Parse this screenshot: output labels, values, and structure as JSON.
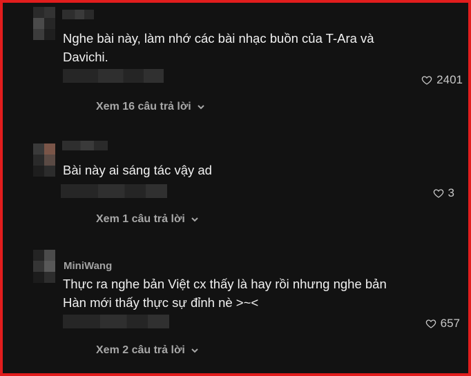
{
  "comments": [
    {
      "username": "",
      "text": "Nghe bài này, làm nhớ các bài nhạc buồn của T-Ara và Davichi.",
      "likes": "2401",
      "replies_label": "Xem 16 câu trả lời"
    },
    {
      "username": "",
      "text": "Bài này ai sáng tác vậy ad",
      "likes": "3",
      "replies_label": "Xem 1 câu trả lời"
    },
    {
      "username": "MiniWang",
      "text": "Thực ra nghe bản Việt cx thấy là hay rồi nhưng nghe bản Hàn mới thấy thực sự đỉnh nè >~<",
      "likes": "657",
      "replies_label": "Xem 2 câu trả lời"
    }
  ],
  "icons": {
    "like": "heart-outline-icon",
    "expand": "chevron-down-icon"
  },
  "colors": {
    "frame_border": "#e11d1d",
    "background": "#121212",
    "text": "#f1f1f1",
    "muted": "#a8a8a8"
  }
}
